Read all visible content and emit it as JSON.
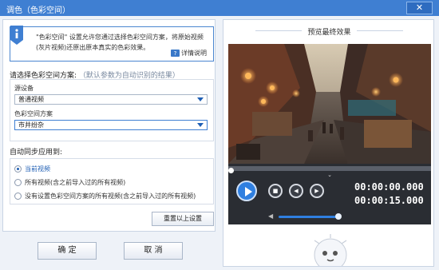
{
  "window": {
    "title": "调色（色彩空间）",
    "close_label": "✕"
  },
  "info": {
    "text": "\"色彩空间\" 设置允许您通过选择色彩空间方案，将原始视频(灰片视频)还原出原本真实的色彩效果。",
    "help_label": "详情说明"
  },
  "colorspace": {
    "section_title": "请选择色彩空间方案:",
    "section_hint": "（默认参数为自动识别的结果）",
    "source_label": "源设备",
    "source_value": "普通视频",
    "scheme_label": "色彩空间方案",
    "scheme_value": "市井纷杂"
  },
  "apply": {
    "section_title": "自动同步应用到:",
    "options": [
      {
        "label": "当前视频",
        "checked": true
      },
      {
        "label": "所有视频(含之前导入过的所有视频)",
        "checked": false
      },
      {
        "label": "没有设置色彩空间方案的所有视频(含之前导入过的所有视频)",
        "checked": false
      }
    ],
    "reset_label": "重置以上设置"
  },
  "buttons": {
    "ok": "确 定",
    "cancel": "取 消"
  },
  "preview": {
    "title": "预览最终效果",
    "current_time": "00:00:00.000",
    "total_time": "00:00:15.000",
    "progress": 0.0,
    "volume": 0.8
  },
  "colors": {
    "accent": "#3f7fd2",
    "play": "#2f7fe0",
    "player_bg": "#2a2d33"
  }
}
